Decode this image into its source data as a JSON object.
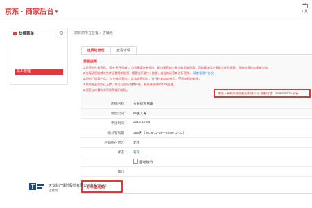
{
  "header": {
    "logo_text": "京东 · 商家后台",
    "logo_caret": "▾",
    "tools_label": "工具"
  },
  "sidebar": {
    "title": "快捷菜单",
    "item_label": "员工管理"
  },
  "breadcrumb": "您目前所在位置 > 店铺险",
  "tabs": [
    {
      "label": "运费险管理",
      "active": true
    },
    {
      "label": "查看详情",
      "active": false
    }
  ],
  "notice": {
    "title": "重要提醒：",
    "lines": [
      "1.运费险在保费后，将出“天平保单”，会员需要先有保险，解决保费减少参与的相关问题，同时解决用户退换大件的报害，理赔的保险以保单为准。",
      "2.为保证您能够对大件运费险单投保，需要先开通“+1 比量，或当地运营商进行保单。",
      "3.因他门投保产品，为“中能运费险”，此店运费险时，进行核对3000单后，不影响您的处理。",
      "4.您的营业执照已上传，您可以进行保费补贴，具体请咨询800-09处理。",
      "5.您可以申请向小天联系我们处理。"
    ],
    "link_text": "请查看用户协议",
    "highlight_text": "中国人寿财产保险股份有限公司 客服电话：4006695515 天安"
  },
  "form": [
    {
      "label": "店铺名称：",
      "value": "金融街迎驾家"
    },
    {
      "label": "保险公司：",
      "value": "中国人寿"
    },
    {
      "label": "申请时间：",
      "value": "2016-11-08"
    },
    {
      "label": "缴付有效期：",
      "value": "365天（2016-12-08—2099-12-31）"
    },
    {
      "label": "店铺所在地区：",
      "value": "北京"
    },
    {
      "label": "状态：",
      "value": "有效",
      "status": "active"
    },
    {
      "label": "",
      "value": "自动续约",
      "checkbox": true
    },
    {
      "label": "操作：",
      "value": ""
    }
  ],
  "section": {
    "title": "天平保险险"
  },
  "company": {
    "name": "天安财产保险股份有限公司北京分公司",
    "sub": "运费险"
  },
  "colors": {
    "accent": "#e4393c",
    "status_active": "#2a9a3a",
    "link": "#3b7fd8"
  }
}
